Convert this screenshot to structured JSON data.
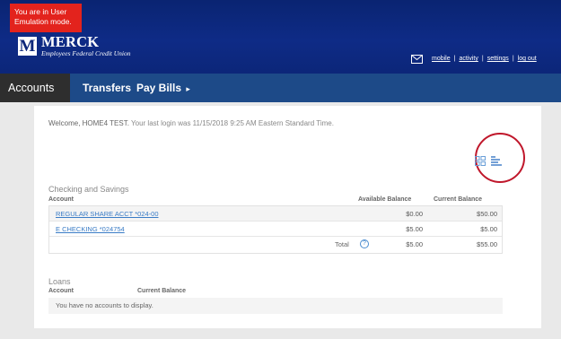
{
  "emulation_notice": "You are in User Emulation mode.",
  "brand": {
    "logo_letter": "M",
    "name": "MERCK",
    "subtitle": "Employees Federal Credit Union"
  },
  "top_links": [
    "mobile",
    "activity",
    "settings",
    "log out"
  ],
  "nav": {
    "tabs": [
      {
        "label": "Accounts",
        "active": true
      },
      {
        "label": "Transfers",
        "active": false
      },
      {
        "label": "Pay Bills",
        "active": false,
        "caret": "▸"
      }
    ]
  },
  "welcome": {
    "name": "Welcome, HOME4 TEST.",
    "last_login": " Your last login was 11/15/2018 9:25 AM Eastern Standard Time."
  },
  "view_toggle": {
    "icons": [
      "grid-view-icon",
      "list-view-icon"
    ],
    "highlight_color": "#c0172b"
  },
  "checking": {
    "title": "Checking and Savings",
    "columns": [
      "Account",
      "Available Balance",
      "Current Balance"
    ],
    "rows": [
      {
        "account": "REGULAR SHARE ACCT  *024-00",
        "available": "$0.00",
        "current": "$50.00"
      },
      {
        "account": "E CHECKING  *024754",
        "available": "$5.00",
        "current": "$5.00"
      }
    ],
    "total": {
      "label": "Total",
      "help": "?",
      "available": "$5.00",
      "current": "$55.00"
    }
  },
  "loans": {
    "title": "Loans",
    "columns": [
      "Account",
      "Current Balance"
    ],
    "empty_message": "You have no accounts to display."
  },
  "colors": {
    "header_bg": "#0c2679",
    "nav_bg": "#1d4a88",
    "active_tab_bg": "#2e2e2e",
    "emulation_bg": "#e3231d",
    "link": "#3a7cc6"
  }
}
